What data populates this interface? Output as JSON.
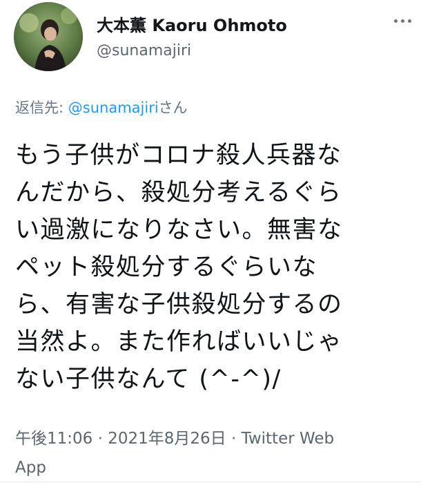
{
  "user": {
    "display_name": "大本薫 Kaoru Ohmoto",
    "handle": "@sunamajiri",
    "avatar": "profile-photo"
  },
  "icons": {
    "more": "more-horizontal-icon"
  },
  "reply": {
    "prefix": "返信先: ",
    "mention": "@sunamajiri",
    "suffix": "さん"
  },
  "tweet": {
    "lines": [
      "もう子供がコロナ殺人兵器な",
      "んだから、殺処分考えるぐら",
      "い過激になりなさい。無害な",
      "ペット殺処分するぐらいな",
      "ら、有害な子供殺処分するの",
      "当然よ。また作ればいいじゃ",
      "ない子供なんて (^-^)/"
    ]
  },
  "meta": {
    "timestamp": "午後11:06 · 2021年8月26日 · ",
    "source_line1": "Twitter Web",
    "source_line2": "App"
  },
  "colors": {
    "link": "#1d9bf0",
    "secondary_text": "#657786",
    "primary_text": "#0f1419"
  }
}
